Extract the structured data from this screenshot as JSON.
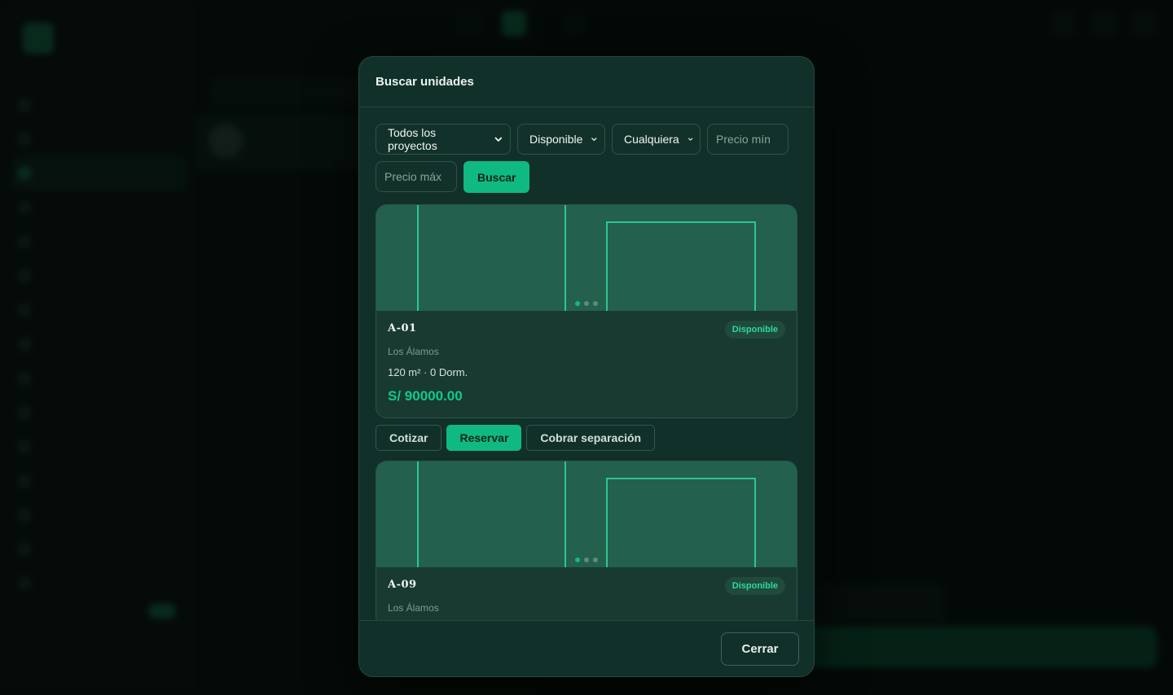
{
  "modal": {
    "title": "Buscar unidades",
    "filters": {
      "project": "Todos los proyectos",
      "status": "Disponible",
      "bedrooms": "Cualquiera",
      "price_min_placeholder": "Precio mín",
      "price_max_placeholder": "Precio máx",
      "search_label": "Buscar"
    },
    "units": [
      {
        "code": "A-01",
        "status": "Disponible",
        "project": "Los Álamos",
        "specs": "120 m² · 0 Dorm.",
        "price": "S/ 90000.00"
      },
      {
        "code": "A-09",
        "status": "Disponible",
        "project": "Los Álamos"
      }
    ],
    "actions": {
      "quote": "Cotizar",
      "reserve": "Reservar",
      "charge": "Cobrar separación"
    },
    "close_label": "Cerrar"
  },
  "colors": {
    "accent": "#10b981",
    "modal_bg": "#11302a",
    "image_bg": "#23604d"
  }
}
